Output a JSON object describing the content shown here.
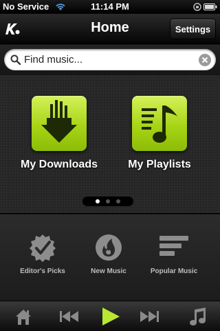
{
  "status_bar": {
    "carrier": "No Service",
    "time": "11:14 PM",
    "icons": [
      "wifi-icon",
      "rotation-lock-icon",
      "battery-icon"
    ]
  },
  "nav": {
    "title": "Home",
    "settings_label": "Settings",
    "logo_icon": "app-logo-icon"
  },
  "search": {
    "placeholder": "Find music...",
    "icons": [
      "search-icon",
      "clear-icon"
    ]
  },
  "tiles": [
    {
      "label": "My Downloads",
      "icon": "download-arrow-icon"
    },
    {
      "label": "My Playlists",
      "icon": "music-note-list-icon"
    }
  ],
  "pager": {
    "pages": 3,
    "current": 1
  },
  "categories": [
    {
      "label": "Editor's Picks",
      "icon": "checkmark-badge-icon"
    },
    {
      "label": "New Music",
      "icon": "flame-globe-icon"
    },
    {
      "label": "Popular Music",
      "icon": "bars-icon"
    }
  ],
  "tab_bar": {
    "items": [
      "home-icon",
      "previous-track-icon",
      "play-icon",
      "next-track-icon",
      "music-note-icon"
    ]
  },
  "colors": {
    "accent_green": "#a8d416",
    "play_green": "#b8e832"
  }
}
